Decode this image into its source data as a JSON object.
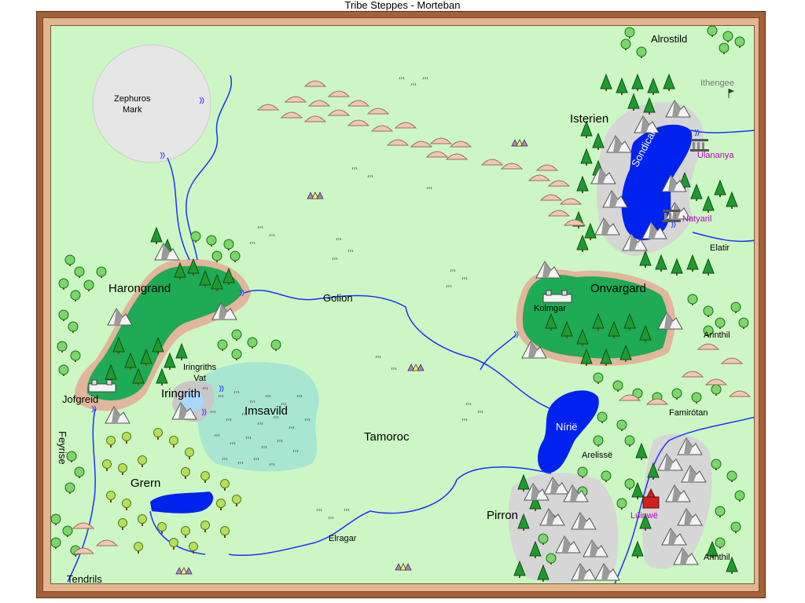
{
  "window": {
    "title": "Tribe Steppes - Morteban"
  },
  "map": {
    "regions": {
      "zephuros_mark": [
        "Zephuros",
        "Mark"
      ],
      "harongrand": "Harongrand",
      "isterien": "Isterien",
      "onvargard": "Onvargard",
      "iringrith": "Iringrith",
      "imsavild": "Imsavild",
      "tamoroc": "Tamoroc",
      "grern": "Grern",
      "pirron": "Pirron",
      "feyrise": "Feyrise",
      "tendrils": "Tendrils"
    },
    "places": {
      "alrostild": "Alrostild",
      "ithengee": "Ithengee",
      "ulananya": "Ulananya",
      "natyaril": "Natyaril",
      "elatir": "Elatir",
      "kolmgar": "Kolmgar",
      "arinthil_east": "Arinthil",
      "famirotan": "Famirótan",
      "arelisse": "Arelissë",
      "luinwe": "Lúinwë",
      "arinthil_south": "Arinthil",
      "jofgreid": "Jofgreid",
      "iringriths_vat": [
        "Iringriths",
        "Vat"
      ],
      "golion": "Golion",
      "elragar": "Elragar"
    },
    "lakes": {
      "sondicar": "Sondicar",
      "nirie": "Níriё"
    },
    "colors": {
      "plains": "#ccf7c4",
      "forest": "#1faa55",
      "water": "#0022ee",
      "river": "#1a32ff",
      "mountain": "#d4d4d4",
      "frame": "#a5603a",
      "magenta_label": "#c000c0"
    },
    "icons": [
      "tree-icon",
      "mountain-icon",
      "hill-icon",
      "tent-icon",
      "temple-icon",
      "castle-icon",
      "fortress-icon",
      "flag-icon",
      "grass-tuft-icon"
    ]
  }
}
